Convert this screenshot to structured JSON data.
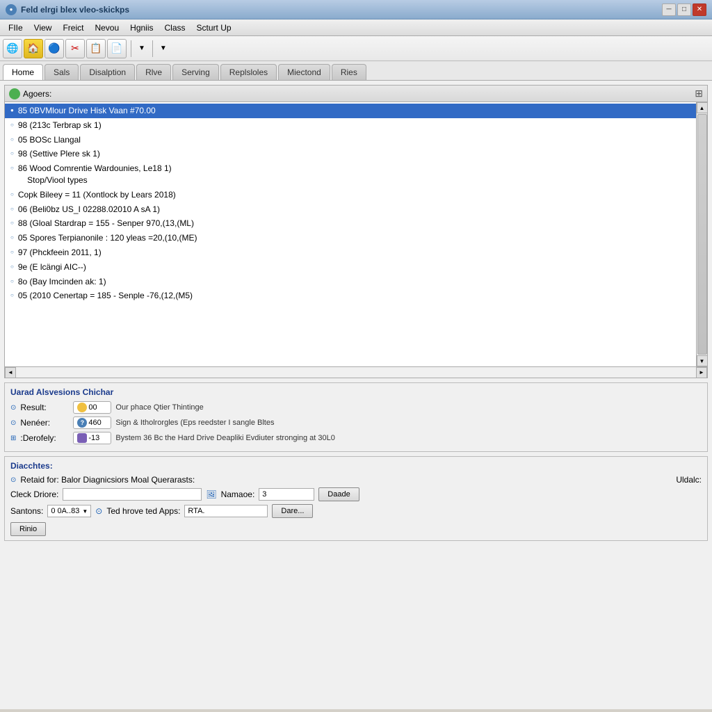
{
  "titlebar": {
    "text": "Feld elrgi blex vleo-skickps",
    "icon": "●"
  },
  "menu": {
    "items": [
      "FIIe",
      "View",
      "Freict",
      "Nevou",
      "Hgniis",
      "Class",
      "Scturt Up"
    ]
  },
  "toolbar": {
    "buttons": [
      {
        "icon": "🌐",
        "name": "globe"
      },
      {
        "icon": "🏠",
        "name": "home"
      },
      {
        "icon": "🎭",
        "name": "mask"
      },
      {
        "icon": "✂",
        "name": "scissors"
      },
      {
        "icon": "📋",
        "name": "clipboard"
      },
      {
        "icon": "📄",
        "name": "document"
      }
    ],
    "arrow1": "▼",
    "arrow2": "▼"
  },
  "tabs": {
    "items": [
      "Home",
      "Sals",
      "Disalption",
      "Rlve",
      "Serving",
      "Replsloles",
      "Miectond",
      "Ries"
    ],
    "active_index": 0
  },
  "agents": {
    "title": "Agoers:",
    "icon": "●",
    "items": [
      {
        "text": "85 0BVMlour Drive Hisk Vaan #70.00",
        "selected": true
      },
      {
        "text": "98 (213c Terbrap sk 1)",
        "selected": false
      },
      {
        "text": "05 BOSc Llangal",
        "selected": false
      },
      {
        "text": "98 (Settive Plere sk 1)",
        "selected": false
      },
      {
        "text": "86 Wood Comrentie Wardounies, Le18 1)\nStop/Viool types",
        "selected": false
      },
      {
        "text": "Copk Bileey = 11 (Xontlock by Lears 2018)",
        "selected": false
      },
      {
        "text": "06 (Beli0bz US_I 02288.02010 A sA 1)",
        "selected": false
      },
      {
        "text": "88 (Gloal Stardrap = 155 - Senper 970,(13,(ML)",
        "selected": false
      },
      {
        "text": "05 Spores Terpianonile : 120 yleas =20,(10,(ME)",
        "selected": false
      },
      {
        "text": "97 (Phckfeein 2011, 1)",
        "selected": false
      },
      {
        "text": "9e (E lcängi AIC--)",
        "selected": false
      },
      {
        "text": "8o (Bay Imcinden ak: 1)",
        "selected": false
      },
      {
        "text": "05 (2010 Cenertap = 185 - Senple -76,(12,(M5)",
        "selected": false
      }
    ]
  },
  "status_section": {
    "title": "Uarad Alsvesions Chichar",
    "rows": [
      {
        "has_radio": true,
        "label": "Result:",
        "badge_icon": "●",
        "badge_color": "green",
        "badge_value": "00",
        "description": "Our phace Qtier Thintinge"
      },
      {
        "has_radio": true,
        "label": "Nenéer:",
        "badge_icon": "?",
        "badge_color": "blue",
        "badge_value": "460",
        "description": "Sign & Itholrorgles (Eps reedster I sangle Bltes"
      },
      {
        "has_radio": true,
        "label": ":Derofely:",
        "badge_icon": "■",
        "badge_color": "purple",
        "badge_value": "-13",
        "description": "Bystem 36 Bc the Hard Drive Deapliki Evdiuter stronging at 30L0"
      }
    ]
  },
  "diagnostics": {
    "title": "Diacchtes:",
    "retaid_label": "Retaid for: Balor Diagnicsiors Moal Querarasts:",
    "uldalc_label": "Uldalc:",
    "cleck_label": "Cleck Driore:",
    "cleck_value": "",
    "namaoe_label": "Namaoe:",
    "namaoe_value": "3",
    "daade_btn": "Daade",
    "santons_label": "Santons:",
    "santons_value": "0 0A..83",
    "ted_label": "Ted hrove ted Apps:",
    "ted_value": "RTA.",
    "dare_btn": "Dare...",
    "rinio_btn": "Rinio"
  },
  "colors": {
    "accent": "#1a3a8c",
    "selected_bg": "#316ac5",
    "green_badge": "#f0c040",
    "blue_badge": "#4a7fb5",
    "purple_badge": "#7a5fb5"
  }
}
